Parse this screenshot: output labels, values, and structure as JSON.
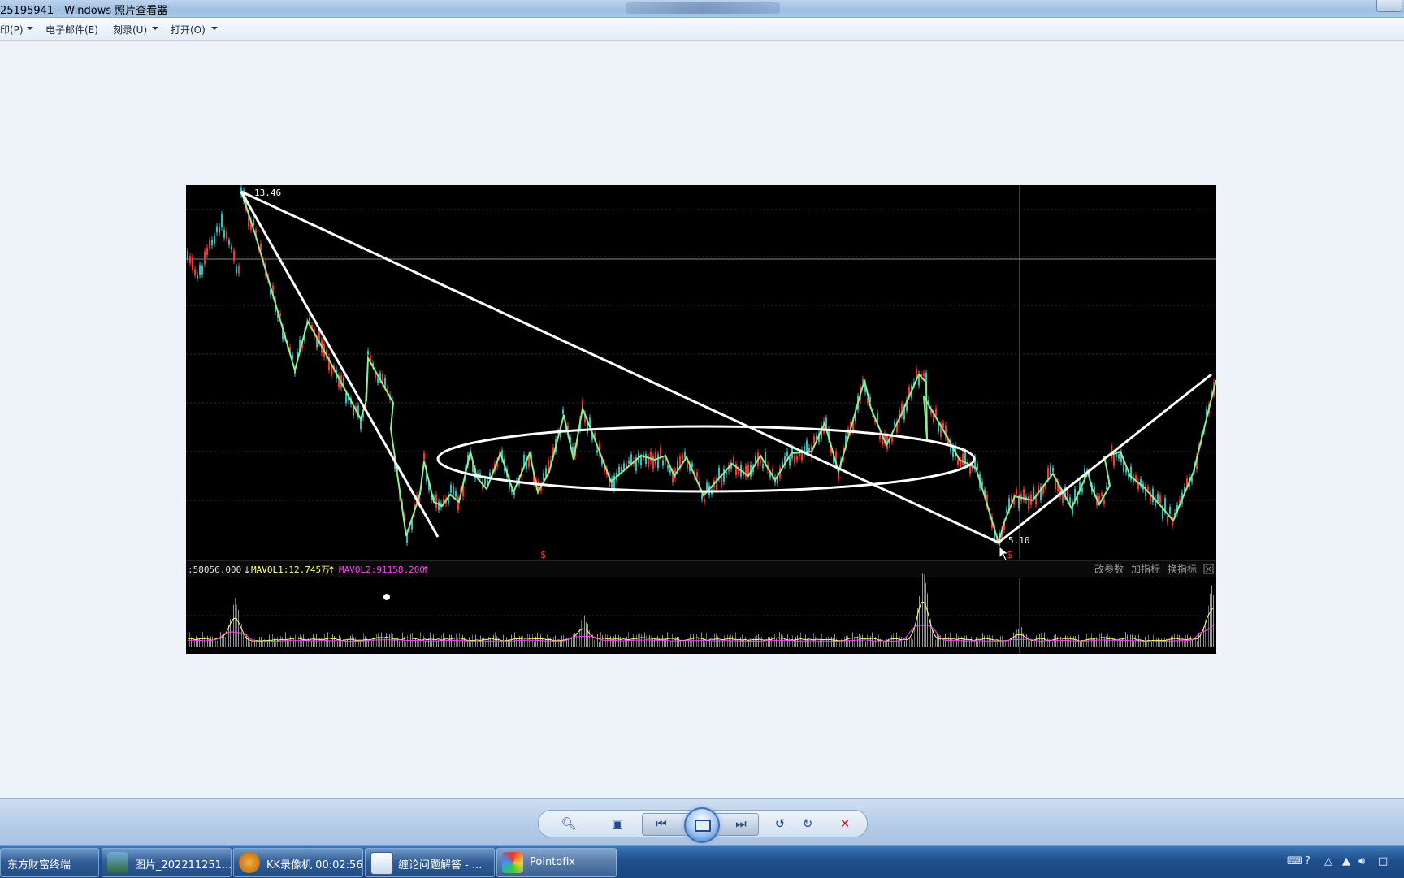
{
  "window": {
    "title": "25195941 - Windows 照片查看器"
  },
  "menu": {
    "items": [
      {
        "label": "印(P)"
      },
      {
        "label": "电子邮件(E)"
      },
      {
        "label": "刻录(U)"
      },
      {
        "label": "打开(O)"
      }
    ]
  },
  "chart": {
    "high_label": "13.46",
    "low_label": "5.10",
    "marker_symbol": "$",
    "volume_label": ":58056.000",
    "mavol1_label": "MAVOL1:12.745万",
    "mavol2_label": "MAVOL2:91158.200",
    "buttons": [
      "改参数",
      "加指标",
      "换指标"
    ],
    "colors": {
      "zigzag": "#90ee90",
      "trendline": "#ffffff",
      "mavol1": "#ffff80",
      "mavol2": "#ff40ff",
      "candle_up": "#ff3030",
      "candle_down": "#30c0c0"
    }
  },
  "toolbar": {
    "icons": [
      "zoom-icon",
      "fit-icon",
      "previous-icon",
      "slideshow-icon",
      "next-icon",
      "rotate-left-icon",
      "rotate-right-icon",
      "delete-icon"
    ]
  },
  "taskbar": {
    "items": [
      {
        "label": "东方财富终端"
      },
      {
        "label": "图片_202211251..."
      },
      {
        "label": "KK录像机 00:02:56"
      },
      {
        "label": "缠论问题解答 - ..."
      },
      {
        "label": "Pointofix"
      }
    ]
  }
}
